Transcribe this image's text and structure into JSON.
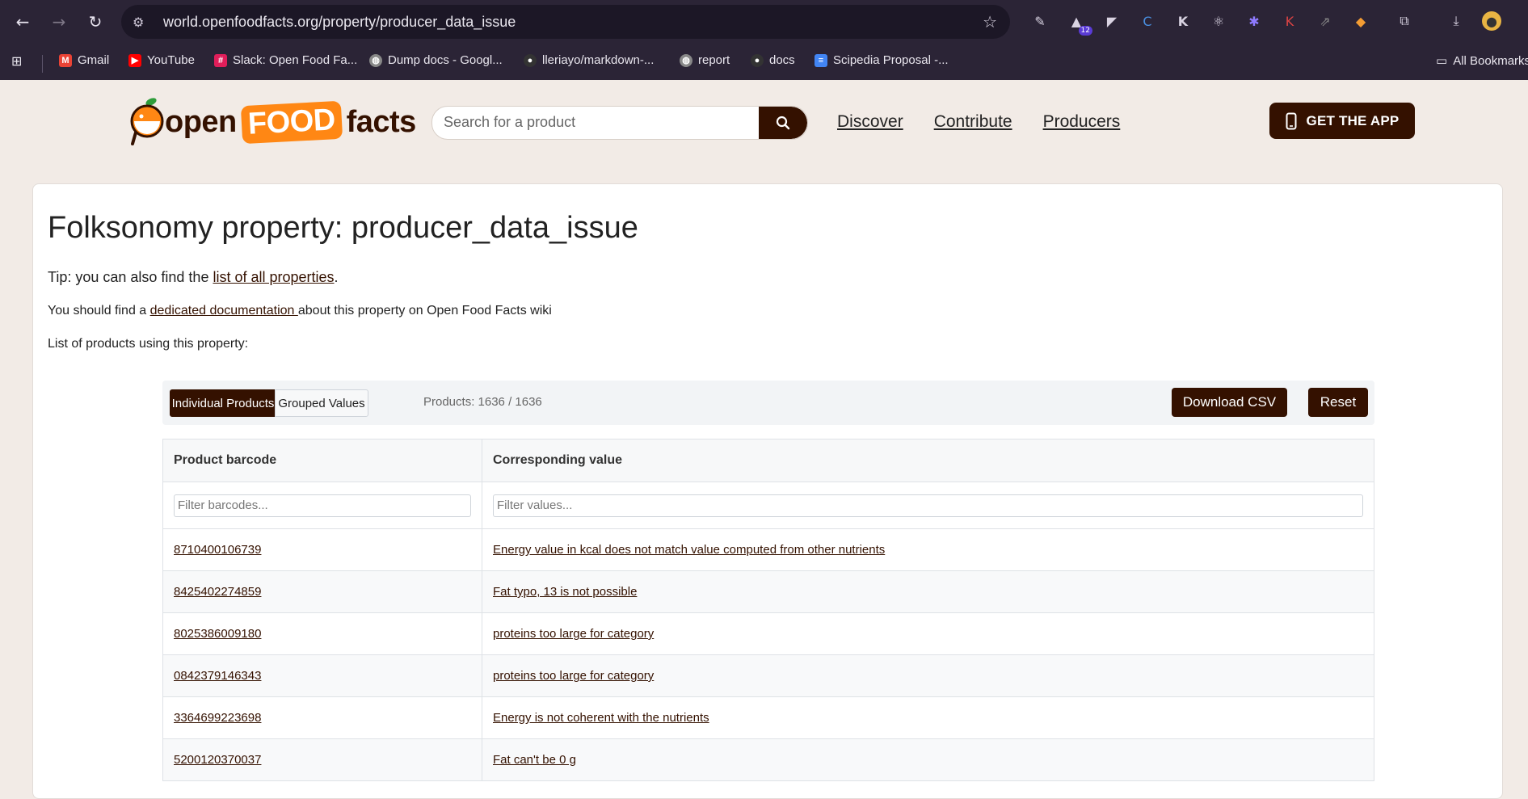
{
  "browser": {
    "url": "world.openfoodfacts.org/property/producer_data_issue",
    "extension_badge": "12",
    "bookmarks": [
      {
        "label": "Gmail",
        "icon": "gmail-icon",
        "color": "#ea4335"
      },
      {
        "label": "YouTube",
        "icon": "youtube-icon",
        "color": "#ff0000"
      },
      {
        "label": "Slack: Open Food Fa...",
        "icon": "slack-icon",
        "color": "#e01e5a"
      },
      {
        "label": "Dump docs - Googl...",
        "icon": "globe-icon",
        "color": "#888888"
      },
      {
        "label": "lleriayo/markdown-...",
        "icon": "github-icon",
        "color": "#333333"
      },
      {
        "label": "report",
        "icon": "globe-icon",
        "color": "#888888"
      },
      {
        "label": "docs",
        "icon": "github-icon",
        "color": "#333333"
      },
      {
        "label": "Scipedia Proposal -...",
        "icon": "docs-icon",
        "color": "#4285f4"
      }
    ],
    "all_bookmarks": "All Bookmarks"
  },
  "site": {
    "logo_open": "open",
    "logo_food": "FOOD",
    "logo_facts": "facts",
    "search_placeholder": "Search for a product",
    "nav": [
      "Discover",
      "Contribute",
      "Producers"
    ],
    "app_button": "GET THE APP"
  },
  "page": {
    "title": "Folksonomy property: producer_data_issue",
    "tip_prefix": "Tip: you can also find the ",
    "tip_link": "list of all properties",
    "tip_suffix": ".",
    "doc_prefix": "You should find a ",
    "doc_link": "dedicated documentation ",
    "doc_suffix": "about this property on Open Food Facts wiki",
    "list_label": "List of products using this property:"
  },
  "toolbar": {
    "tab_individual": "Individual Products",
    "tab_grouped": "Grouped Values",
    "count": "Products: 1636 / 1636",
    "download": "Download CSV",
    "reset": "Reset"
  },
  "table": {
    "col_barcode": "Product barcode",
    "col_value": "Corresponding value",
    "filter_barcode_placeholder": "Filter barcodes...",
    "filter_value_placeholder": "Filter values...",
    "rows": [
      {
        "barcode": "8710400106739",
        "value": "Energy value in kcal does not match value computed from other nutrients"
      },
      {
        "barcode": "8425402274859",
        "value": "Fat typo, 13 is not possible"
      },
      {
        "barcode": "8025386009180",
        "value": "proteins too large for category"
      },
      {
        "barcode": "0842379146343",
        "value": "proteins too large for category"
      },
      {
        "barcode": "3364699223698",
        "value": "Energy is not coherent with the nutrients"
      },
      {
        "barcode": "5200120370037",
        "value": "Fat can't be 0 g"
      }
    ]
  },
  "colors": {
    "brand_brown": "#341100",
    "brand_orange": "#ff8714",
    "chrome_bg": "#2b2436"
  }
}
